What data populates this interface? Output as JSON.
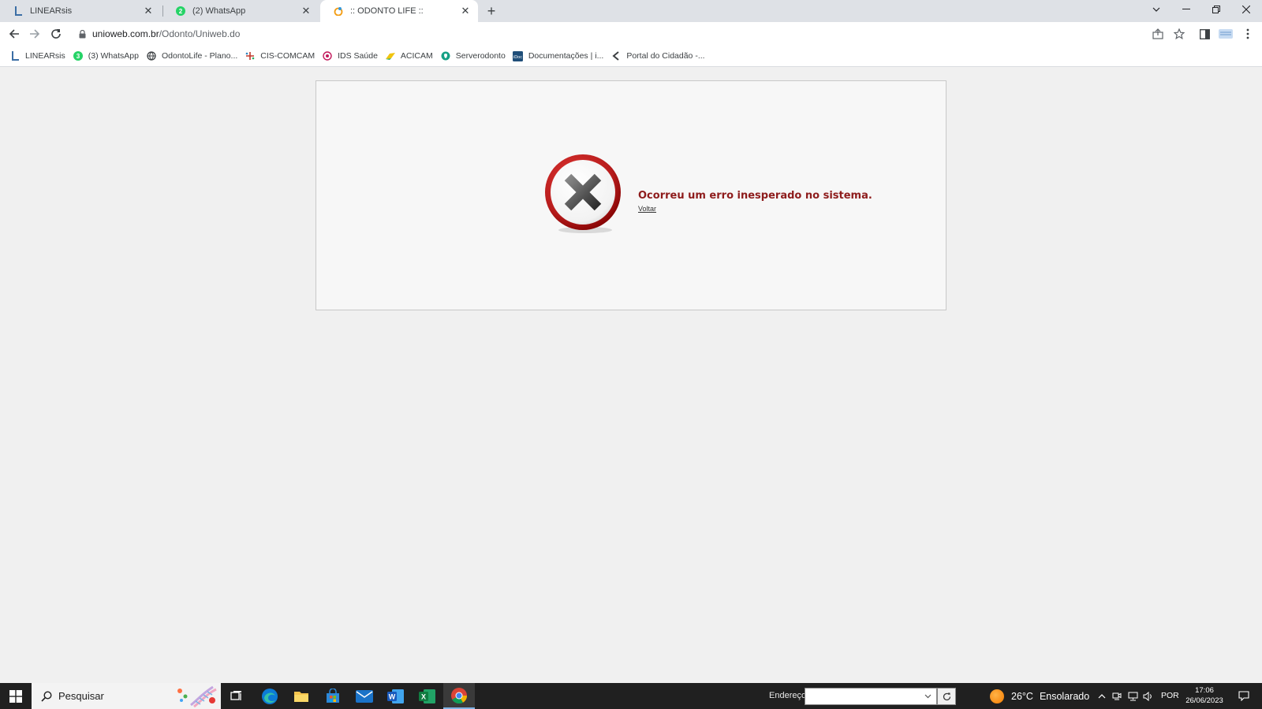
{
  "browser": {
    "tabs": [
      {
        "title": "LINEARsis",
        "icon": "linearsis-icon"
      },
      {
        "title": "(2) WhatsApp",
        "icon": "whatsapp-icon"
      },
      {
        "title": ":: ODONTO LIFE ::",
        "icon": "odontolife-icon",
        "active": true
      }
    ],
    "url_host": "unioweb.com.br",
    "url_path": "/Odonto/Uniweb.do",
    "bookmarks": [
      {
        "label": "LINEARsis",
        "icon": "linearsis-icon"
      },
      {
        "label": "(3) WhatsApp",
        "icon": "whatsapp-icon"
      },
      {
        "label": "OdontoLife - Plano...",
        "icon": "globe-icon"
      },
      {
        "label": "CIS-COMCAM",
        "icon": "cis-icon"
      },
      {
        "label": "IDS Saúde",
        "icon": "ids-icon"
      },
      {
        "label": "ACICAM",
        "icon": "acicam-icon"
      },
      {
        "label": "Serverodonto",
        "icon": "serverodonto-icon"
      },
      {
        "label": "Documentações | i...",
        "icon": "docs-icon"
      },
      {
        "label": "Portal do Cidadão -...",
        "icon": "portal-icon"
      }
    ]
  },
  "page": {
    "error_message": "Ocorreu um erro inesperado no sistema.",
    "back_link": "Voltar",
    "error_icon": "error-x-icon",
    "colors": {
      "error_text": "#8e1c1c",
      "error_ring": "#c62828"
    }
  },
  "taskbar": {
    "search_placeholder": "Pesquisar",
    "address_label": "Endereço",
    "address_value": "",
    "weather_temp": "26°C",
    "weather_desc": "Ensolarado",
    "language": "POR",
    "time": "17:06",
    "date": "26/06/2023"
  }
}
